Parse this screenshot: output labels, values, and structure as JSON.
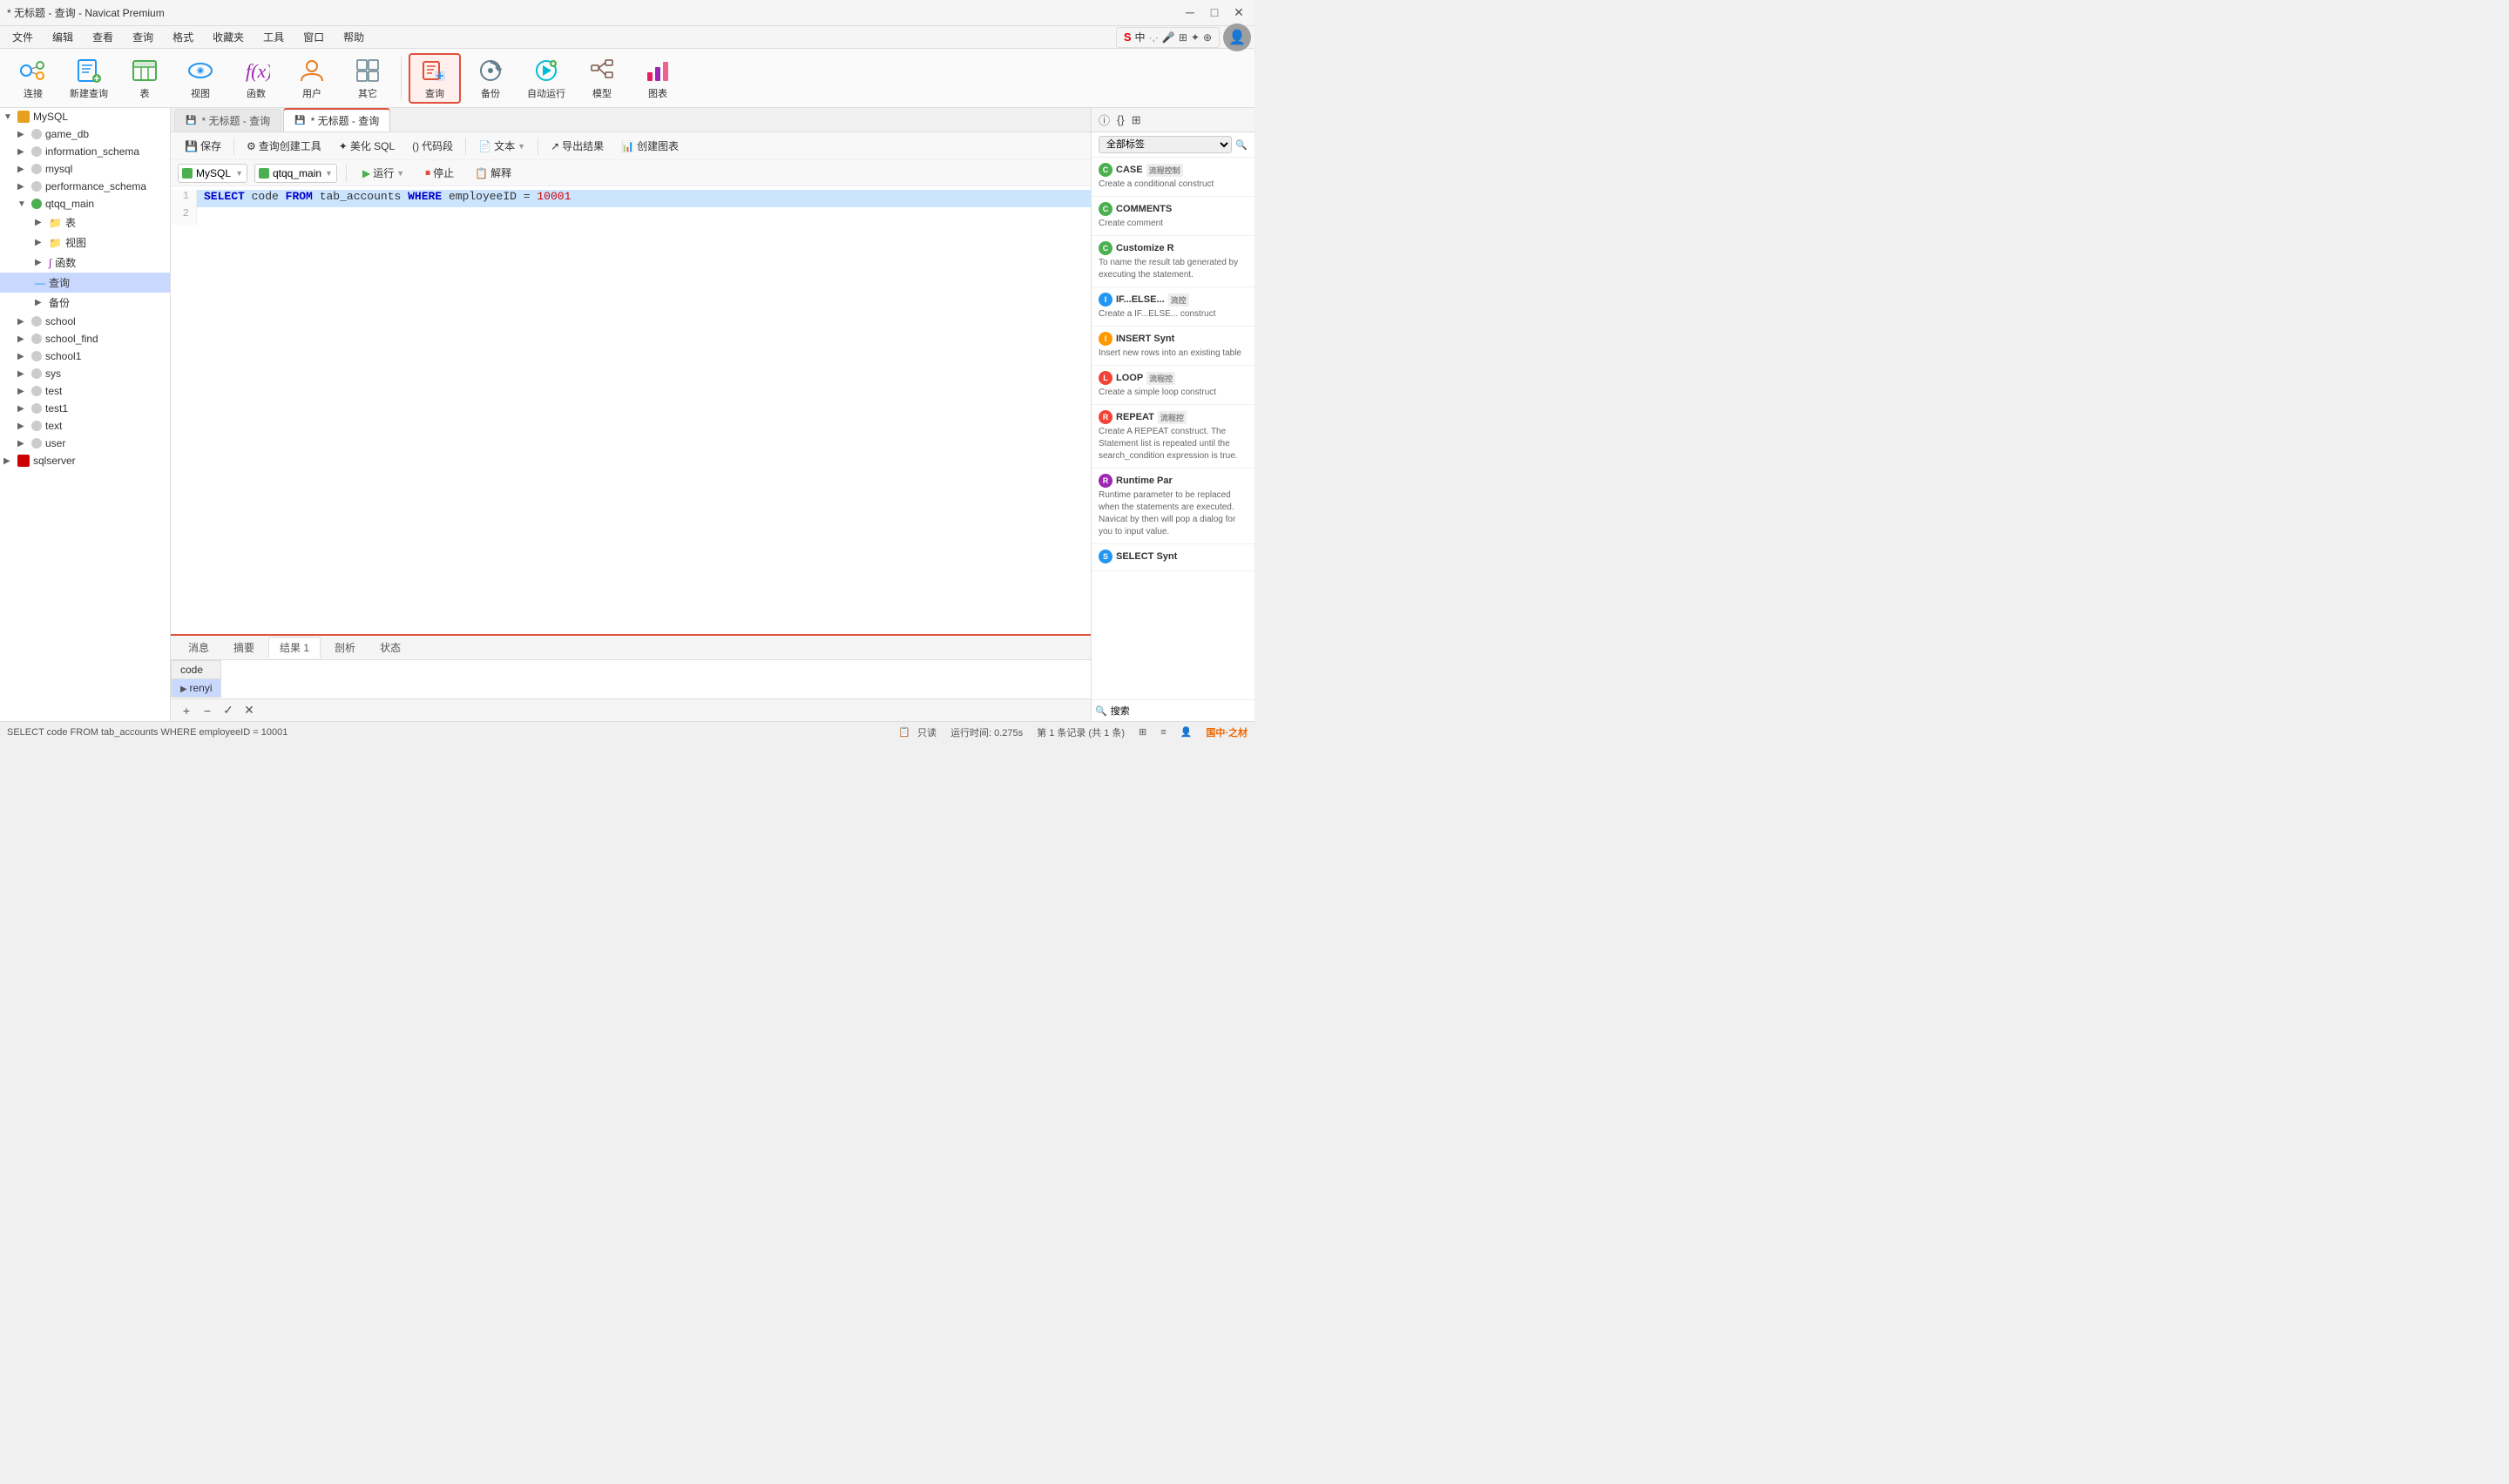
{
  "titlebar": {
    "title": "* 无标题 - 查询 - Navicat Premium",
    "minimize": "─",
    "maximize": "□",
    "close": "✕"
  },
  "menubar": {
    "items": [
      "文件",
      "编辑",
      "查看",
      "查询",
      "格式",
      "收藏夹",
      "工具",
      "窗口",
      "帮助"
    ]
  },
  "toolbar": {
    "buttons": [
      {
        "id": "connect",
        "label": "连接"
      },
      {
        "id": "new-query",
        "label": "新建查询"
      },
      {
        "id": "table",
        "label": "表"
      },
      {
        "id": "view",
        "label": "视图"
      },
      {
        "id": "func",
        "label": "函数"
      },
      {
        "id": "user",
        "label": "用户"
      },
      {
        "id": "other",
        "label": "其它"
      },
      {
        "id": "query",
        "label": "查询"
      },
      {
        "id": "backup",
        "label": "备份"
      },
      {
        "id": "auto-run",
        "label": "自动运行"
      },
      {
        "id": "model",
        "label": "模型"
      },
      {
        "id": "chart",
        "label": "图表"
      }
    ]
  },
  "tabs": [
    {
      "id": "tab1",
      "label": "* 无标题 - 查询",
      "active": false
    },
    {
      "id": "tab2",
      "label": "* 无标题 - 查询",
      "active": true
    }
  ],
  "query_toolbar": {
    "save": "保存",
    "query_create": "查询创建工具",
    "beautify": "美化 SQL",
    "code_snippet": "代码段",
    "text": "文本",
    "export": "导出结果",
    "create_chart": "创建图表"
  },
  "conn_bar": {
    "db_type": "MySQL",
    "db_name": "qtqq_main",
    "run": "运行",
    "stop": "停止",
    "explain": "解释"
  },
  "sql_editor": {
    "lines": [
      {
        "num": "1",
        "content": "SELECT code FROM tab_accounts WHERE employeeID = 10001"
      },
      {
        "num": "2",
        "content": ""
      }
    ]
  },
  "result_tabs": [
    "消息",
    "摘要",
    "结果 1",
    "剖析",
    "状态"
  ],
  "result_active_tab": "结果 1",
  "result_data": {
    "columns": [
      "code"
    ],
    "rows": [
      {
        "arrow": true,
        "values": [
          "renyi"
        ]
      }
    ]
  },
  "bottom_toolbar": {
    "add": "+",
    "remove": "−",
    "confirm": "✓",
    "cancel": "✕"
  },
  "statusbar": {
    "sql_text": "SELECT code FROM tab_accounts WHERE employeeID = 10001",
    "mode": "只读",
    "time": "运行时间: 0.275s",
    "records": "第 1 条记录 (共 1 条)"
  },
  "sidebar": {
    "root": "MySQL",
    "databases": [
      {
        "name": "game_db",
        "expanded": false
      },
      {
        "name": "information_schema",
        "expanded": false
      },
      {
        "name": "mysql",
        "expanded": false
      },
      {
        "name": "performance_schema",
        "expanded": false
      },
      {
        "name": "qtqq_main",
        "expanded": true,
        "children": [
          {
            "type": "folder",
            "name": "表"
          },
          {
            "type": "folder",
            "name": "视图"
          },
          {
            "type": "folder",
            "name": "函数"
          },
          {
            "type": "item",
            "name": "查询",
            "selected": true
          }
        ]
      },
      {
        "name": "备份",
        "expanded": false,
        "indent": 1
      }
    ],
    "other_dbs": [
      {
        "name": "school",
        "expanded": false
      },
      {
        "name": "school_find",
        "expanded": false
      },
      {
        "name": "school1",
        "expanded": false
      },
      {
        "name": "sys",
        "expanded": false
      },
      {
        "name": "test",
        "expanded": false
      },
      {
        "name": "test1",
        "expanded": false
      },
      {
        "name": "text",
        "expanded": false
      },
      {
        "name": "user",
        "expanded": false
      }
    ],
    "sqlserver": {
      "name": "sqlserver"
    }
  },
  "right_panel": {
    "header_icons": [
      "info",
      "code",
      "grid"
    ],
    "filter_label": "全部标签",
    "snippets": [
      {
        "id": "case",
        "title": "CASE",
        "badge": "流程控制",
        "desc": "Create a conditional construct"
      },
      {
        "id": "comments",
        "title": "COMMENTS",
        "badge": "",
        "desc": "Create comment"
      },
      {
        "id": "customize-r",
        "title": "Customize R",
        "badge": "",
        "desc": "To name the result tab generated by executing the statement."
      },
      {
        "id": "if-else",
        "title": "IF...ELSE...",
        "badge": "流控",
        "desc": "Create a IF...ELSE... construct"
      },
      {
        "id": "insert-synt",
        "title": "INSERT Synt",
        "badge": "",
        "desc": "Insert new rows into an existing table"
      },
      {
        "id": "loop",
        "title": "LOOP",
        "badge": "流程控",
        "desc": "Create a simple loop construct"
      },
      {
        "id": "repeat",
        "title": "REPEAT",
        "badge": "流程控",
        "desc": "Create A REPEAT construct. The Statement list is repeated until the search_condition expression is true."
      },
      {
        "id": "runtime-par",
        "title": "Runtime Par",
        "badge": "",
        "desc": "Runtime parameter to be replaced when the statements are executed. Navicat by then will pop a dialog for you to input value."
      },
      {
        "id": "select-synt",
        "title": "SELECT Synt",
        "badge": "",
        "desc": ""
      }
    ]
  },
  "icons": {
    "case_color": "#4caf50",
    "comments_color": "#4caf50",
    "customize_color": "#4caf50",
    "ifelse_color": "#2196f3",
    "insert_color": "#ff9800",
    "loop_color": "#f44336",
    "repeat_color": "#f44336",
    "runtime_color": "#9c27b0",
    "select_color": "#2196f3"
  }
}
